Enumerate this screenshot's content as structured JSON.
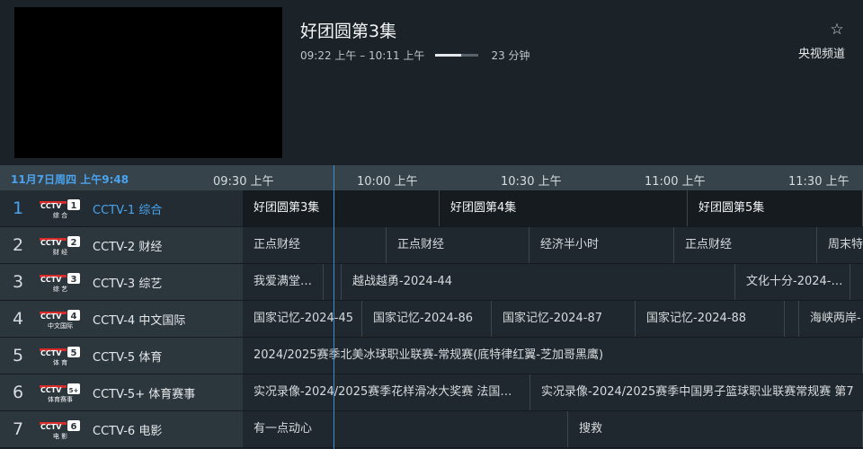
{
  "now_playing": {
    "title": "好团圆第3集",
    "time_range": "09:22 上午 – 10:11 上午",
    "progress_fraction": 0.6,
    "remaining": "23 分钟",
    "channel_group": "央视频道"
  },
  "timeline": {
    "current": "11月7日周四 上午9:48",
    "ticks": [
      "09:30 上午",
      "10:00 上午",
      "10:30 上午",
      "11:00 上午",
      "11:30 上午"
    ]
  },
  "colors": {
    "accent": "#4aa3ef",
    "logo_red": "#d62b2b"
  },
  "channels": [
    {
      "number": "1",
      "logo_icon": "cctv-1-logo-icon",
      "logo_num": "1",
      "logo_sub": "综 合",
      "name": "CCTV-1 综合",
      "programs": [
        "好团圆第3集",
        "好团圆第4集",
        "好团圆第5集"
      ]
    },
    {
      "number": "2",
      "logo_icon": "cctv-2-logo-icon",
      "logo_num": "2",
      "logo_sub": "财 经",
      "name": "CCTV-2 财经",
      "programs": [
        "正点财经",
        "正点财经",
        "经济半小时",
        "正点财经",
        "周末特"
      ]
    },
    {
      "number": "3",
      "logo_icon": "cctv-3-logo-icon",
      "logo_num": "3",
      "logo_sub": "综 艺",
      "name": "CCTV-3 综艺",
      "programs": [
        "我爱满堂…",
        "",
        "越战越勇-2024-44",
        "文化十分-2024-…",
        ""
      ]
    },
    {
      "number": "4",
      "logo_icon": "cctv-4-logo-icon",
      "logo_num": "4",
      "logo_sub": "中文国际",
      "name": "CCTV-4 中文国际",
      "programs": [
        "国家记忆-2024-45",
        "国家记忆-2024-86",
        "国家记忆-2024-87",
        "国家记忆-2024-88",
        "",
        "海峡两岸-"
      ]
    },
    {
      "number": "5",
      "logo_icon": "cctv-5-logo-icon",
      "logo_num": "5",
      "logo_sub": "体 育",
      "name": "CCTV-5 体育",
      "programs": [
        "2024/2025赛季北美冰球职业联赛-常规赛(底特律红翼-芝加哥黑鹰)"
      ]
    },
    {
      "number": "6",
      "logo_icon": "cctv-5plus-logo-icon",
      "logo_num": "5+",
      "logo_sub": "体育赛事",
      "name": "CCTV-5+ 体育赛事",
      "programs": [
        "实况录像-2024/2025赛季花样滑冰大奖赛 法国…",
        "实况录像-2024/2025赛季中国男子篮球职业联赛常规赛 第7"
      ]
    },
    {
      "number": "7",
      "logo_icon": "cctv-6-logo-icon",
      "logo_num": "6",
      "logo_sub": "电 影",
      "name": "CCTV-6 电影",
      "programs": [
        "有一点动心",
        "搜救"
      ]
    }
  ]
}
